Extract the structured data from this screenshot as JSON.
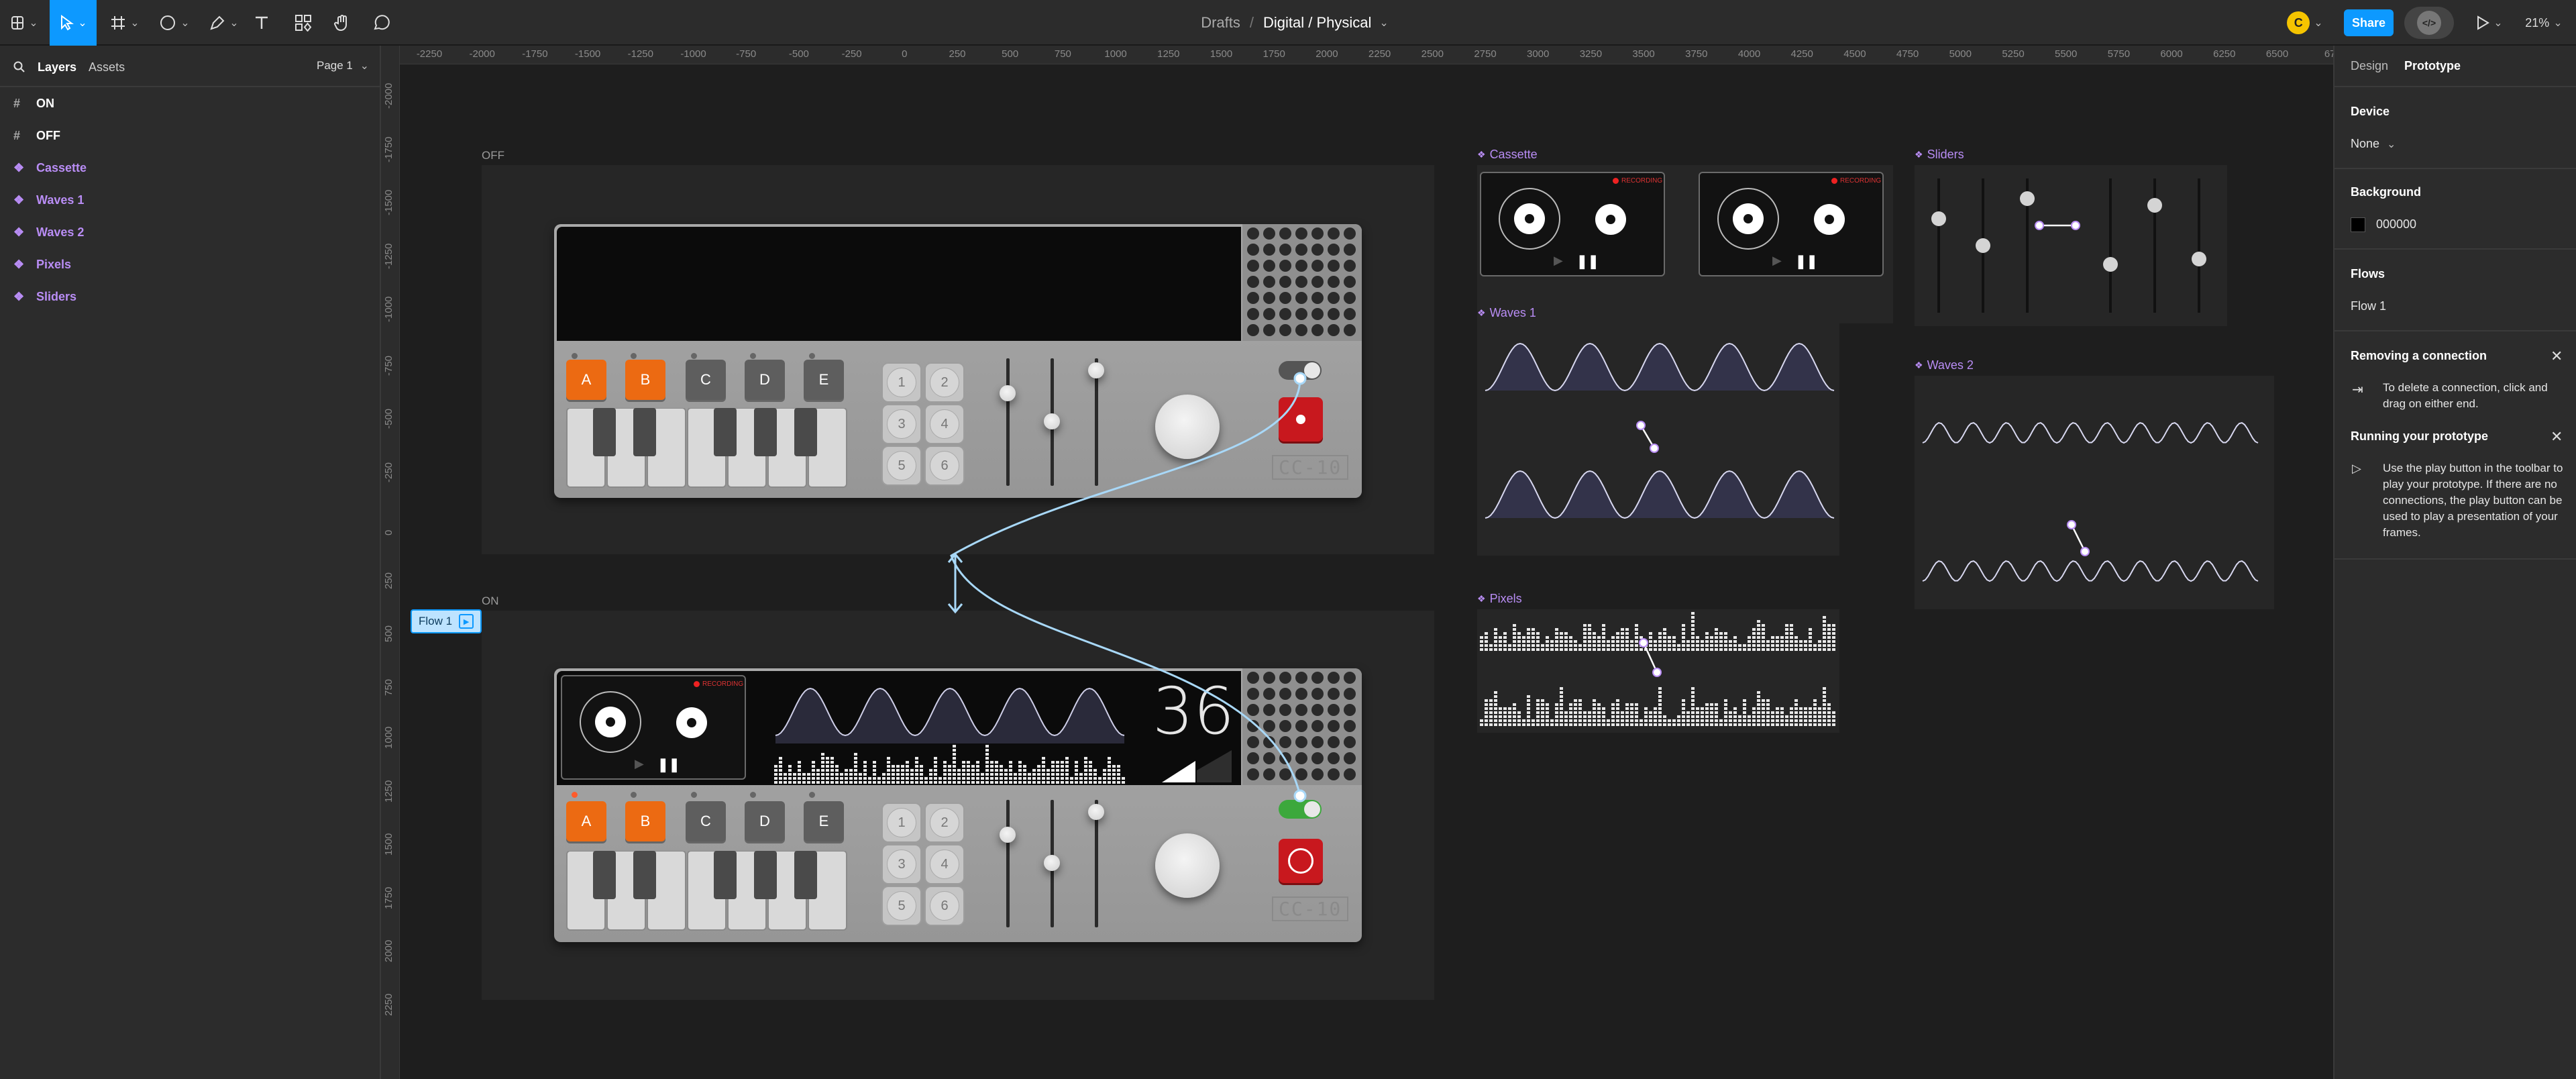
{
  "topbar": {
    "breadcrumb_root": "Drafts",
    "breadcrumb_sep": "/",
    "file_title": "Digital / Physical",
    "avatar_letter": "C",
    "share_label": "Share",
    "zoom": "21%"
  },
  "left": {
    "tabs": [
      "Layers",
      "Assets"
    ],
    "page_label": "Page 1",
    "layers": [
      {
        "label": "ON",
        "kind": "frame"
      },
      {
        "label": "OFF",
        "kind": "frame"
      },
      {
        "label": "Cassette",
        "kind": "component"
      },
      {
        "label": "Waves 1",
        "kind": "component"
      },
      {
        "label": "Waves 2",
        "kind": "component"
      },
      {
        "label": "Pixels",
        "kind": "component"
      },
      {
        "label": "Sliders",
        "kind": "component"
      }
    ]
  },
  "right": {
    "tabs": [
      "Design",
      "Prototype"
    ],
    "device_heading": "Device",
    "device_value": "None",
    "background_heading": "Background",
    "background_value": "000000",
    "flows_heading": "Flows",
    "flow_item": "Flow 1",
    "removing_title": "Removing a connection",
    "removing_text": "To delete a connection, click and drag on either end.",
    "running_title": "Running your prototype",
    "running_text": "Use the play button in the toolbar to play your prototype. If there are no connections, the play button can be used to play a presentation of your frames."
  },
  "rulers": {
    "h_ticks": [
      "-2250",
      "-2000",
      "-1750",
      "-1500",
      "-1250",
      "-1000",
      "-750",
      "-500",
      "-250",
      "0",
      "250",
      "500",
      "750",
      "1000",
      "1250",
      "1500",
      "1750",
      "2000",
      "2250",
      "2500",
      "2750",
      "3000",
      "3250",
      "3500",
      "3750",
      "4000",
      "4250",
      "4500",
      "4750",
      "5000",
      "5250",
      "5500",
      "5750",
      "6000",
      "6250",
      "6500",
      "67"
    ],
    "v_ticks": [
      "-2000",
      "-1750",
      "-1500",
      "-1250",
      "-1000",
      "-750",
      "-500",
      "-250",
      "0",
      "250",
      "500",
      "750",
      "1000",
      "1250",
      "1500",
      "1750",
      "2000",
      "2250"
    ]
  },
  "canvas": {
    "frame_off_label": "OFF",
    "frame_on_label": "ON",
    "flow_badge": "Flow 1",
    "components": {
      "cassette": "Cassette",
      "sliders": "Sliders",
      "waves1": "Waves 1",
      "waves2": "Waves 2",
      "pixels": "Pixels"
    },
    "recording_label": "RECORDING",
    "key_letters": [
      "A",
      "B",
      "C",
      "D",
      "E"
    ],
    "pad_numbers": [
      "1",
      "2",
      "3",
      "4",
      "5",
      "6"
    ],
    "model": "CC-10",
    "display_number": "36"
  },
  "colors": {
    "accent_blue": "#0d99ff",
    "component_purple": "#b98df5",
    "key_orange": "#ec6a12",
    "record_red": "#c8181e",
    "toggle_green": "#3ca83c"
  }
}
